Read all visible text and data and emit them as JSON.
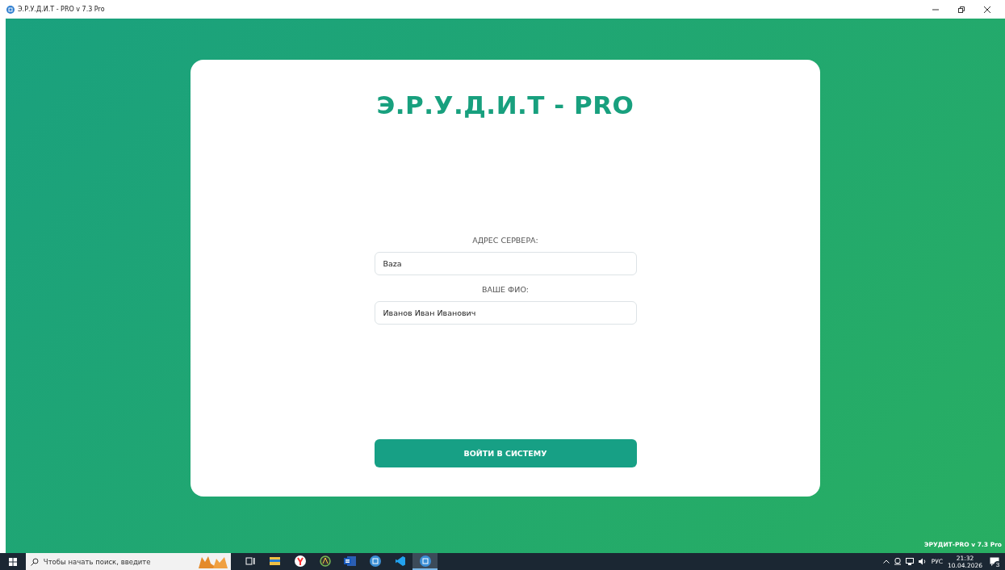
{
  "window": {
    "title": "Э.Р.У.Д.И.Т - PRO v 7.3 Pro"
  },
  "card": {
    "title": "Э.Р.У.Д.И.Т - PRO",
    "fields": [
      {
        "label": "АДРЕС СЕРВЕРА:",
        "value": "Baza"
      },
      {
        "label": "ВАШЕ ФИО:",
        "value": "Иванов Иван Иванович"
      }
    ],
    "button": "ВОЙТИ В СИСТЕМУ"
  },
  "version": "ЭРУДИТ-PRO v 7.3 Pro",
  "taskbar": {
    "search_placeholder": "Чтобы начать поиск, введите",
    "apps": [
      {
        "kind": "taskview",
        "selected": false
      },
      {
        "kind": "folder",
        "selected": false
      },
      {
        "kind": "browser",
        "selected": false
      },
      {
        "kind": "compass",
        "selected": false
      },
      {
        "kind": "word",
        "selected": false
      },
      {
        "kind": "app",
        "selected": false
      },
      {
        "kind": "code",
        "selected": false
      },
      {
        "kind": "app",
        "selected": true
      }
    ],
    "language": "РУС",
    "time": "21:32",
    "date": "10.04.2026",
    "notifications": "3"
  }
}
